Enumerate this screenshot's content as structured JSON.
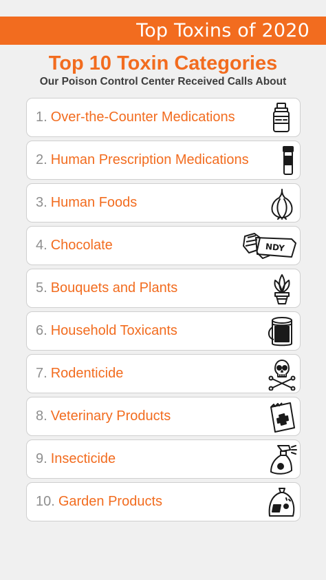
{
  "banner": {
    "title": "Top Toxins of 2020"
  },
  "heading": "Top 10 Toxin Categories",
  "subheading": "Our Poison Control Center Received Calls About",
  "items": [
    {
      "num": "1.",
      "label": "Over-the-Counter Medications",
      "icon": "pill-bottle-icon"
    },
    {
      "num": "2.",
      "label": "Human Prescription Medications",
      "icon": "prescription-bottle-icon"
    },
    {
      "num": "3.",
      "label": "Human Foods",
      "icon": "garlic-icon"
    },
    {
      "num": "4.",
      "label": "Chocolate",
      "icon": "candy-bar-icon"
    },
    {
      "num": "5.",
      "label": "Bouquets and Plants",
      "icon": "potted-plant-icon"
    },
    {
      "num": "6.",
      "label": "Household Toxicants",
      "icon": "paint-can-icon"
    },
    {
      "num": "7.",
      "label": "Rodenticide",
      "icon": "skull-crossbones-icon"
    },
    {
      "num": "8.",
      "label": "Veterinary Products",
      "icon": "medical-bag-icon"
    },
    {
      "num": "9.",
      "label": "Insecticide",
      "icon": "spray-bottle-icon"
    },
    {
      "num": "10.",
      "label": "Garden Products",
      "icon": "fertilizer-bag-icon"
    }
  ],
  "colors": {
    "accent": "#f26c1f",
    "number": "#8e8e8e",
    "background": "#f0f0f0"
  },
  "icon_labels": {
    "candy_bar_wrapper": "NDY"
  }
}
